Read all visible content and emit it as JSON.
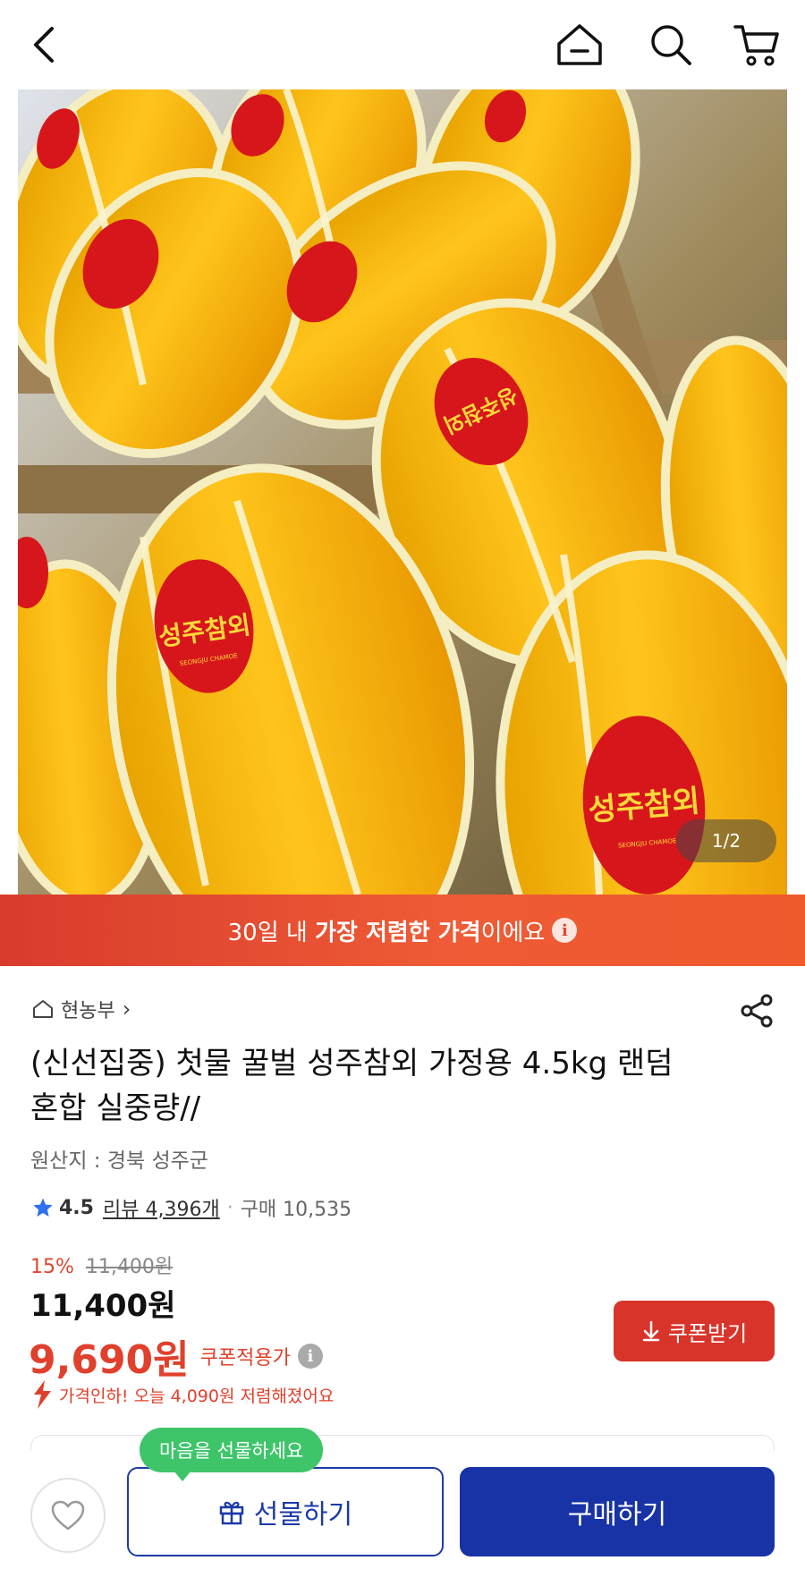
{
  "nav": {
    "back_icon": "chevron-left-icon",
    "home_icon": "home-icon",
    "search_icon": "search-icon",
    "cart_icon": "cart-icon"
  },
  "gallery": {
    "indicator": "1/2",
    "label_text": "성주참외",
    "label_subtext": "SEONGJU CHAMOE"
  },
  "banner": {
    "prefix": "30일 내 ",
    "highlight": "가장 저렴한 가격",
    "suffix": "이에요",
    "info": "i"
  },
  "product": {
    "seller": "현농부",
    "seller_chevron": "›",
    "title": "(신선집중) 첫물 꿀벌 성주참외 가정용 4.5kg 랜덤 혼합 실중량//",
    "origin": "원산지 : 경북 성주군",
    "rating": "4.5",
    "review_link": "리뷰 4,396개",
    "dot": "·",
    "purchase_count": "구매 10,535"
  },
  "pricing": {
    "discount_rate": "15%",
    "original_price": "11,400원",
    "sale_price": "11,400원",
    "coupon_price": "9,690원",
    "coupon_label": "쿠폰적용가",
    "coupon_button": "쿠폰받기",
    "price_drop": "가격인하! 오늘 4,090원 저렴해졌어요",
    "info": "i"
  },
  "bottom": {
    "tooltip": "마음을 선물하세요",
    "gift_button": "선물하기",
    "buy_button": "구매하기"
  },
  "colors": {
    "accent_red": "#e0402c",
    "primary_blue": "#1733a6",
    "tooltip_green": "#3ec56a"
  }
}
